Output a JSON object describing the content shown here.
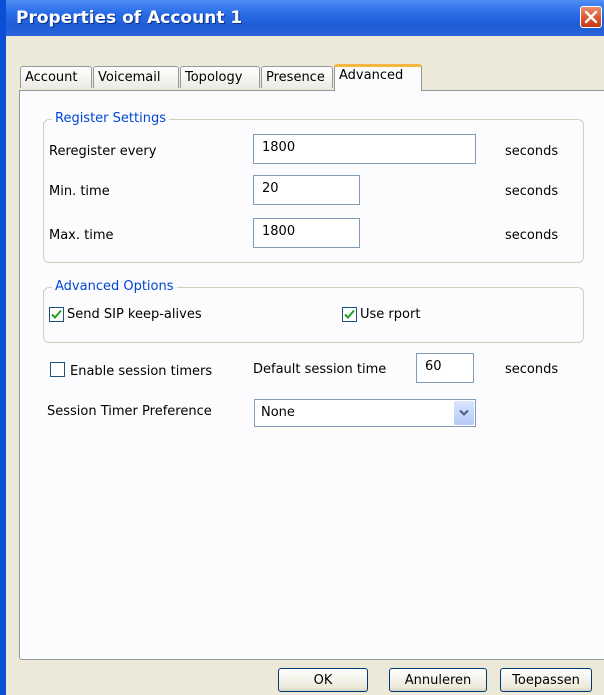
{
  "window": {
    "title": "Properties of Account 1"
  },
  "tabs": [
    {
      "label": "Account"
    },
    {
      "label": "Voicemail"
    },
    {
      "label": "Topology"
    },
    {
      "label": "Presence"
    },
    {
      "label": "Advanced",
      "active": true
    }
  ],
  "register_settings": {
    "legend": "Register Settings",
    "reregister_label": "Reregister every",
    "reregister_value": "1800",
    "min_label": "Min. time",
    "min_value": "20",
    "max_label": "Max. time",
    "max_value": "1800",
    "unit": "seconds"
  },
  "advanced_options": {
    "legend": "Advanced Options",
    "keepalive_label": "Send SIP keep-alives",
    "keepalive_checked": true,
    "rport_label": "Use rport",
    "rport_checked": true
  },
  "session": {
    "enable_label": "Enable session timers",
    "enable_checked": false,
    "default_time_label": "Default session time",
    "default_time_value": "60",
    "unit": "seconds",
    "preference_label": "Session Timer Preference",
    "preference_value": "None"
  },
  "buttons": {
    "ok": "OK",
    "cancel": "Annuleren",
    "apply": "Toepassen"
  },
  "colors": {
    "titlebar": "#2a6ee8",
    "group_label": "#0046d5",
    "check": "#21a121",
    "tab_highlight": "#f4b63c"
  }
}
